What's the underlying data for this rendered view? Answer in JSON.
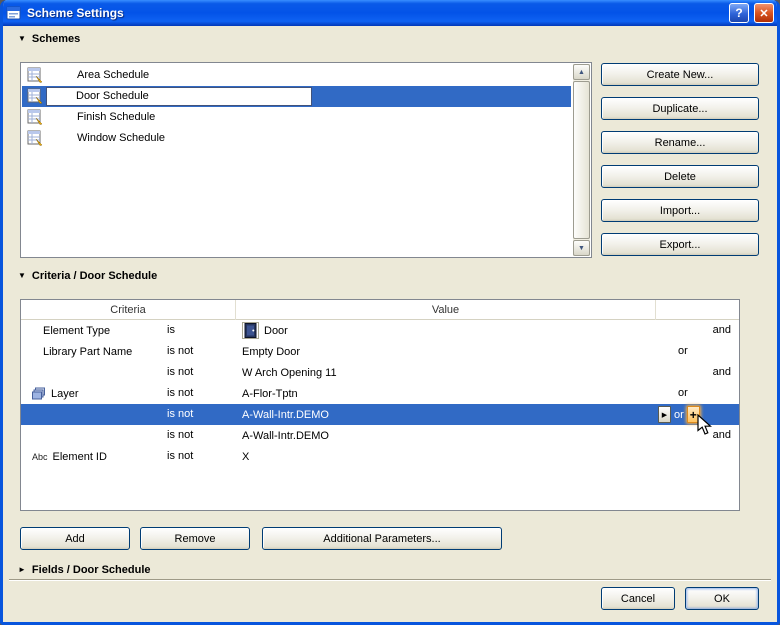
{
  "window": {
    "title": "Scheme Settings",
    "help_button": "?",
    "close_button": "✕"
  },
  "icons": {
    "section_expanded": "▼",
    "section_collapsed": "►",
    "scroll_up": "▲",
    "scroll_down": "▼",
    "value_popup": "▶",
    "add_or_plus": "+"
  },
  "schemes_section": {
    "header": "Schemes",
    "list": [
      {
        "label": "Area Schedule"
      },
      {
        "label": "Door Schedule"
      },
      {
        "label": "Finish Schedule"
      },
      {
        "label": "Window Schedule"
      }
    ],
    "selected_item": "Door Schedule",
    "buttons": [
      "Create New...",
      "Duplicate...",
      "Rename...",
      "Delete",
      "Import...",
      "Export..."
    ]
  },
  "criteria_section": {
    "header": "Criteria / Door Schedule",
    "columns": {
      "criteria": "Criteria",
      "value": "Value"
    },
    "abc_icon_text": "Abc",
    "rows": [
      {
        "criteria": "Element Type",
        "op": "is",
        "value": "Door",
        "conn_and": "and"
      },
      {
        "criteria": "Library Part Name",
        "op": "is not",
        "value": "Empty Door",
        "conn_or": "or"
      },
      {
        "criteria": "",
        "op": "is not",
        "value": "W Arch Opening 11",
        "conn_and": "and"
      },
      {
        "criteria": "Layer",
        "op": "is not",
        "value": "A-Flor-Tptn",
        "conn_or": "or"
      },
      {
        "criteria": "",
        "op": "is not",
        "value": "A-Wall-Intr.DEMO",
        "conn_or": "or"
      },
      {
        "criteria": "",
        "op": "is not",
        "value": "A-Wall-Intr.DEMO",
        "conn_and": "and"
      },
      {
        "criteria": "Element ID",
        "op": "is not",
        "value": "X"
      }
    ],
    "buttons": {
      "add": "Add",
      "remove": "Remove",
      "additional_parameters": "Additional Parameters..."
    }
  },
  "fields_section": {
    "header": "Fields / Door Schedule"
  },
  "footer": {
    "cancel": "Cancel",
    "ok": "OK"
  },
  "colors": {
    "selection": "#316ac5",
    "titlebar_blue": "#0855dd",
    "dialog_bg": "#ece9d8",
    "plus_hover": "#ffb340"
  }
}
